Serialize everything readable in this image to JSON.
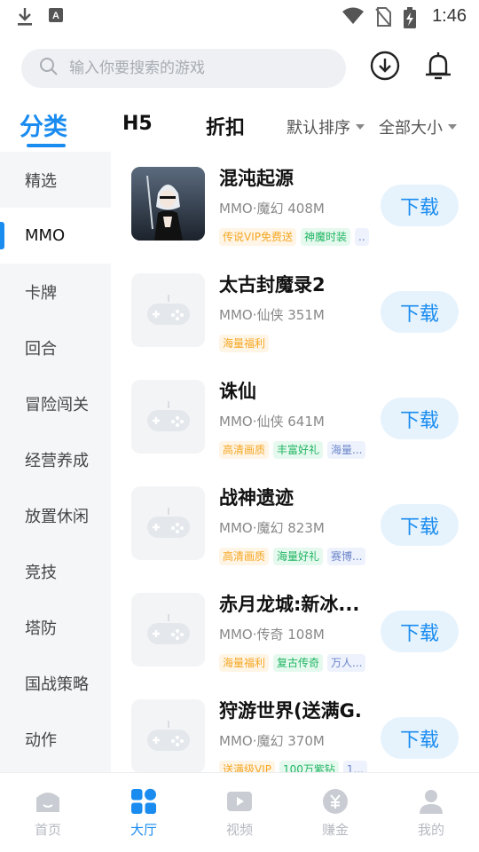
{
  "status_bar": {
    "time": "1:46",
    "icons": [
      "download-icon",
      "a-badge-icon",
      "wifi-icon",
      "no-sim-icon",
      "battery-charging-icon"
    ]
  },
  "search": {
    "placeholder": "输入你要搜索的游戏"
  },
  "header_icons": [
    "download-circle-icon",
    "bell-icon"
  ],
  "tabs": [
    {
      "label": "分类",
      "active": true
    },
    {
      "label": "H5",
      "active": false
    },
    {
      "label": "折扣",
      "active": false
    }
  ],
  "sort": {
    "order_label": "默认排序",
    "size_label": "全部大小"
  },
  "sidebar": {
    "items": [
      {
        "label": "精选",
        "active": false
      },
      {
        "label": "MMO",
        "active": true
      },
      {
        "label": "卡牌",
        "active": false
      },
      {
        "label": "回合",
        "active": false
      },
      {
        "label": "冒险闯关",
        "active": false
      },
      {
        "label": "经营养成",
        "active": false
      },
      {
        "label": "放置休闲",
        "active": false
      },
      {
        "label": "竞技",
        "active": false
      },
      {
        "label": "塔防",
        "active": false
      },
      {
        "label": "国战策略",
        "active": false
      },
      {
        "label": "动作",
        "active": false
      }
    ]
  },
  "games": [
    {
      "title": "混沌起源",
      "meta": "MMO·魔幻  408M",
      "tags": [
        {
          "text": "传说VIP免费送",
          "color": "orange"
        },
        {
          "text": "神魔时装",
          "color": "green"
        },
        {
          "text": "..",
          "color": "blue"
        }
      ],
      "download_label": "下载",
      "has_artwork": true
    },
    {
      "title": "太古封魔录2",
      "meta": "MMO·仙侠  351M",
      "tags": [
        {
          "text": "海量福利",
          "color": "orange"
        }
      ],
      "download_label": "下载",
      "has_artwork": false
    },
    {
      "title": "诛仙",
      "meta": "MMO·仙侠  641M",
      "tags": [
        {
          "text": "高清画质",
          "color": "orange"
        },
        {
          "text": "丰富好礼",
          "color": "green"
        },
        {
          "text": "海量...",
          "color": "blue"
        }
      ],
      "download_label": "下载",
      "has_artwork": false
    },
    {
      "title": "战神遗迹",
      "meta": "MMO·魔幻  823M",
      "tags": [
        {
          "text": "高清画质",
          "color": "orange"
        },
        {
          "text": "海量好礼",
          "color": "green"
        },
        {
          "text": "赛博...",
          "color": "blue"
        }
      ],
      "download_label": "下载",
      "has_artwork": false
    },
    {
      "title": "赤月龙城:新冰...",
      "meta": "MMO·传奇  108M",
      "tags": [
        {
          "text": "海量福利",
          "color": "orange"
        },
        {
          "text": "复古传奇",
          "color": "green"
        },
        {
          "text": "万人...",
          "color": "blue"
        }
      ],
      "download_label": "下载",
      "has_artwork": false
    },
    {
      "title": "狩游世界(送满G...",
      "meta": "MMO·魔幻  370M",
      "tags": [
        {
          "text": "送满级VIP",
          "color": "orange"
        },
        {
          "text": "100万紫钻",
          "color": "green"
        },
        {
          "text": "1...",
          "color": "blue"
        }
      ],
      "download_label": "下载",
      "has_artwork": false
    }
  ],
  "bottom_nav": [
    {
      "label": "首页",
      "icon": "home-icon",
      "active": false
    },
    {
      "label": "大厅",
      "icon": "hall-grid-icon",
      "active": true
    },
    {
      "label": "视频",
      "icon": "video-icon",
      "active": false
    },
    {
      "label": "赚金",
      "icon": "coin-icon",
      "active": false
    },
    {
      "label": "我的",
      "icon": "profile-icon",
      "active": false
    }
  ],
  "colors": {
    "accent": "#1a8cf0",
    "tag_orange": "#f5a623",
    "tag_green": "#1fb562",
    "tag_blue": "#6b85c9"
  }
}
